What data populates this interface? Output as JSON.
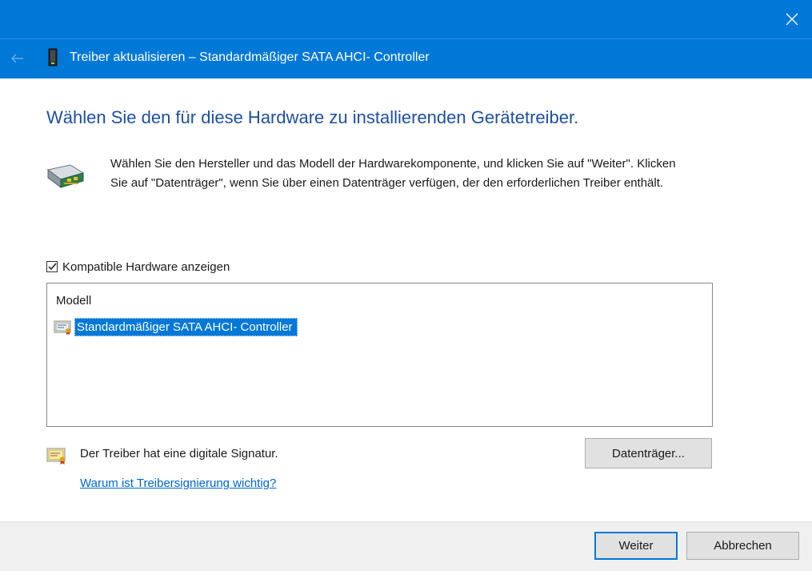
{
  "window": {
    "title": "Treiber aktualisieren – Standardmäßiger SATA AHCI- Controller"
  },
  "main": {
    "heading": "Wählen Sie den für diese Hardware zu installierenden Gerätetreiber.",
    "description": "Wählen Sie den Hersteller und das Modell der Hardwarekomponente, und klicken Sie auf \"Weiter\". Klicken Sie auf \"Datenträger\", wenn Sie über einen Datenträger verfügen, der den erforderlichen Treiber enthält.",
    "compatible_checkbox": {
      "label": "Kompatible Hardware anzeigen",
      "checked": true
    },
    "model_list": {
      "header": "Modell",
      "items": [
        {
          "label": "Standardmäßiger SATA AHCI- Controller",
          "selected": true
        }
      ]
    },
    "signature_text": "Der Treiber hat eine digitale Signatur.",
    "signature_link": "Warum ist Treibersignierung wichtig?",
    "disk_button": "Datenträger..."
  },
  "footer": {
    "next_button": "Weiter",
    "cancel_button": "Abbrechen"
  },
  "colors": {
    "accent": "#0078d7",
    "heading": "#1f4fa0",
    "link": "#0066cc"
  },
  "icons": {
    "close": "close-icon",
    "back": "back-arrow-icon",
    "device": "device-icon",
    "hardware": "hardware-card-icon",
    "signature": "certificate-icon"
  }
}
